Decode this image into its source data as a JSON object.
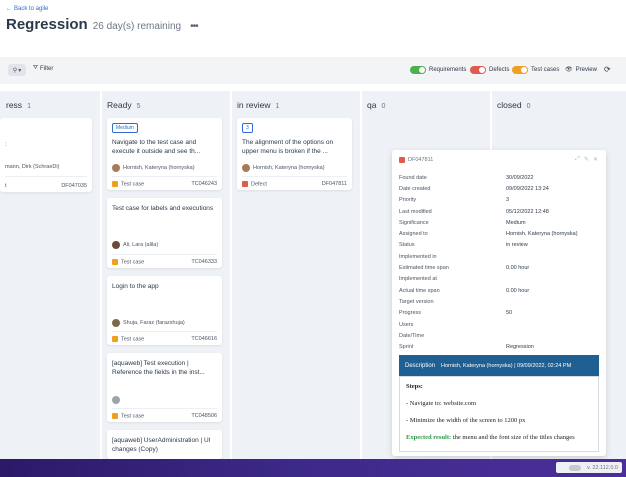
{
  "header": {
    "back_label": "Back to agile",
    "title": "Regression",
    "remaining": "26 day(s) remaining",
    "more": "•••"
  },
  "toolbar": {
    "filter_label": "Filter",
    "requirements_label": "Requirements",
    "defects_label": "Defects",
    "testcases_label": "Test cases",
    "preview_label": "Preview",
    "colors": {
      "requirements": "#4caf50",
      "defects": "#e05a4e",
      "testcases": "#f0a020"
    }
  },
  "columns": [
    {
      "name": "ress",
      "count": "1"
    },
    {
      "name": "Ready",
      "count": "5"
    },
    {
      "name": "in review",
      "count": "1"
    },
    {
      "name": "qa",
      "count": "0"
    },
    {
      "name": "closed",
      "count": "0"
    }
  ],
  "cards": {
    "progress_card": {
      "assignee": "mann, Dirk (SchraeDi)",
      "type": "t",
      "id": "DF047035"
    },
    "ready": [
      {
        "badge": "Medium",
        "title": "Navigate to the test case and execute it outside and see th...",
        "assignee": "Hornish, Kateryna (hornyska)",
        "type": "Test case",
        "id": "TC046243"
      },
      {
        "title": "Test case for labels and executions",
        "assignee": "Ali, Lara (alila)",
        "type": "Test case",
        "id": "TC046333"
      },
      {
        "title": "Login to the app",
        "assignee": "Shuja, Faraz (farazshuja)",
        "type": "Test case",
        "id": "TC046616"
      },
      {
        "title": "[aquaweb] Test execution | Reference the fields in the inst...",
        "type": "Test case",
        "id": "TC048506"
      },
      {
        "title": "[aquaweb] UserAdministration | UI changes (Copy)"
      }
    ],
    "in_review": [
      {
        "badge": "3",
        "title": "The alignment of the options on upper menu is broken if the ...",
        "assignee": "Hornish, Kateryna (hornyska)",
        "type": "Defect",
        "id": "DF047811"
      }
    ]
  },
  "panel": {
    "id": "DF047811",
    "fields": [
      {
        "label": "Found date",
        "value": "30/09/2022"
      },
      {
        "label": "Date created",
        "value": "09/09/2022 13:24"
      },
      {
        "label": "Priority",
        "value": "3"
      },
      {
        "label": "Last modified",
        "value": "05/12/2022 12:48"
      },
      {
        "label": "Significance",
        "value": "Medium"
      },
      {
        "label": "Assigned to",
        "value": "Hornish, Kateryna (hornyska)"
      },
      {
        "label": "Status",
        "value": "in review"
      },
      {
        "label": "Implemented in",
        "value": ""
      },
      {
        "label": "Estimated time span",
        "value": "0.00 hour"
      },
      {
        "label": "Implemented at",
        "value": ""
      },
      {
        "label": "Actual time span",
        "value": "0.00 hour"
      },
      {
        "label": "Target version",
        "value": ""
      },
      {
        "label": "Progress",
        "value": "50"
      },
      {
        "label": "Users",
        "value": ""
      },
      {
        "label": "Date/Time",
        "value": ""
      },
      {
        "label": "Sprint",
        "value": "Regression"
      }
    ],
    "description_label": "Description",
    "description_author": "Hornish, Kateryna (hornyska)",
    "description_sep": "|",
    "description_date": "09/09/2022, 02:24 PM",
    "steps_label": "Steps:",
    "step1": "- Navigate to: website.com",
    "step2": "- Minimize the width of the screen to 1200 px",
    "expected_label": "Expected result:",
    "expected_text": " the menu and the font size of the titles changes"
  },
  "footer": {
    "version": "v. 22.112.0.0"
  }
}
